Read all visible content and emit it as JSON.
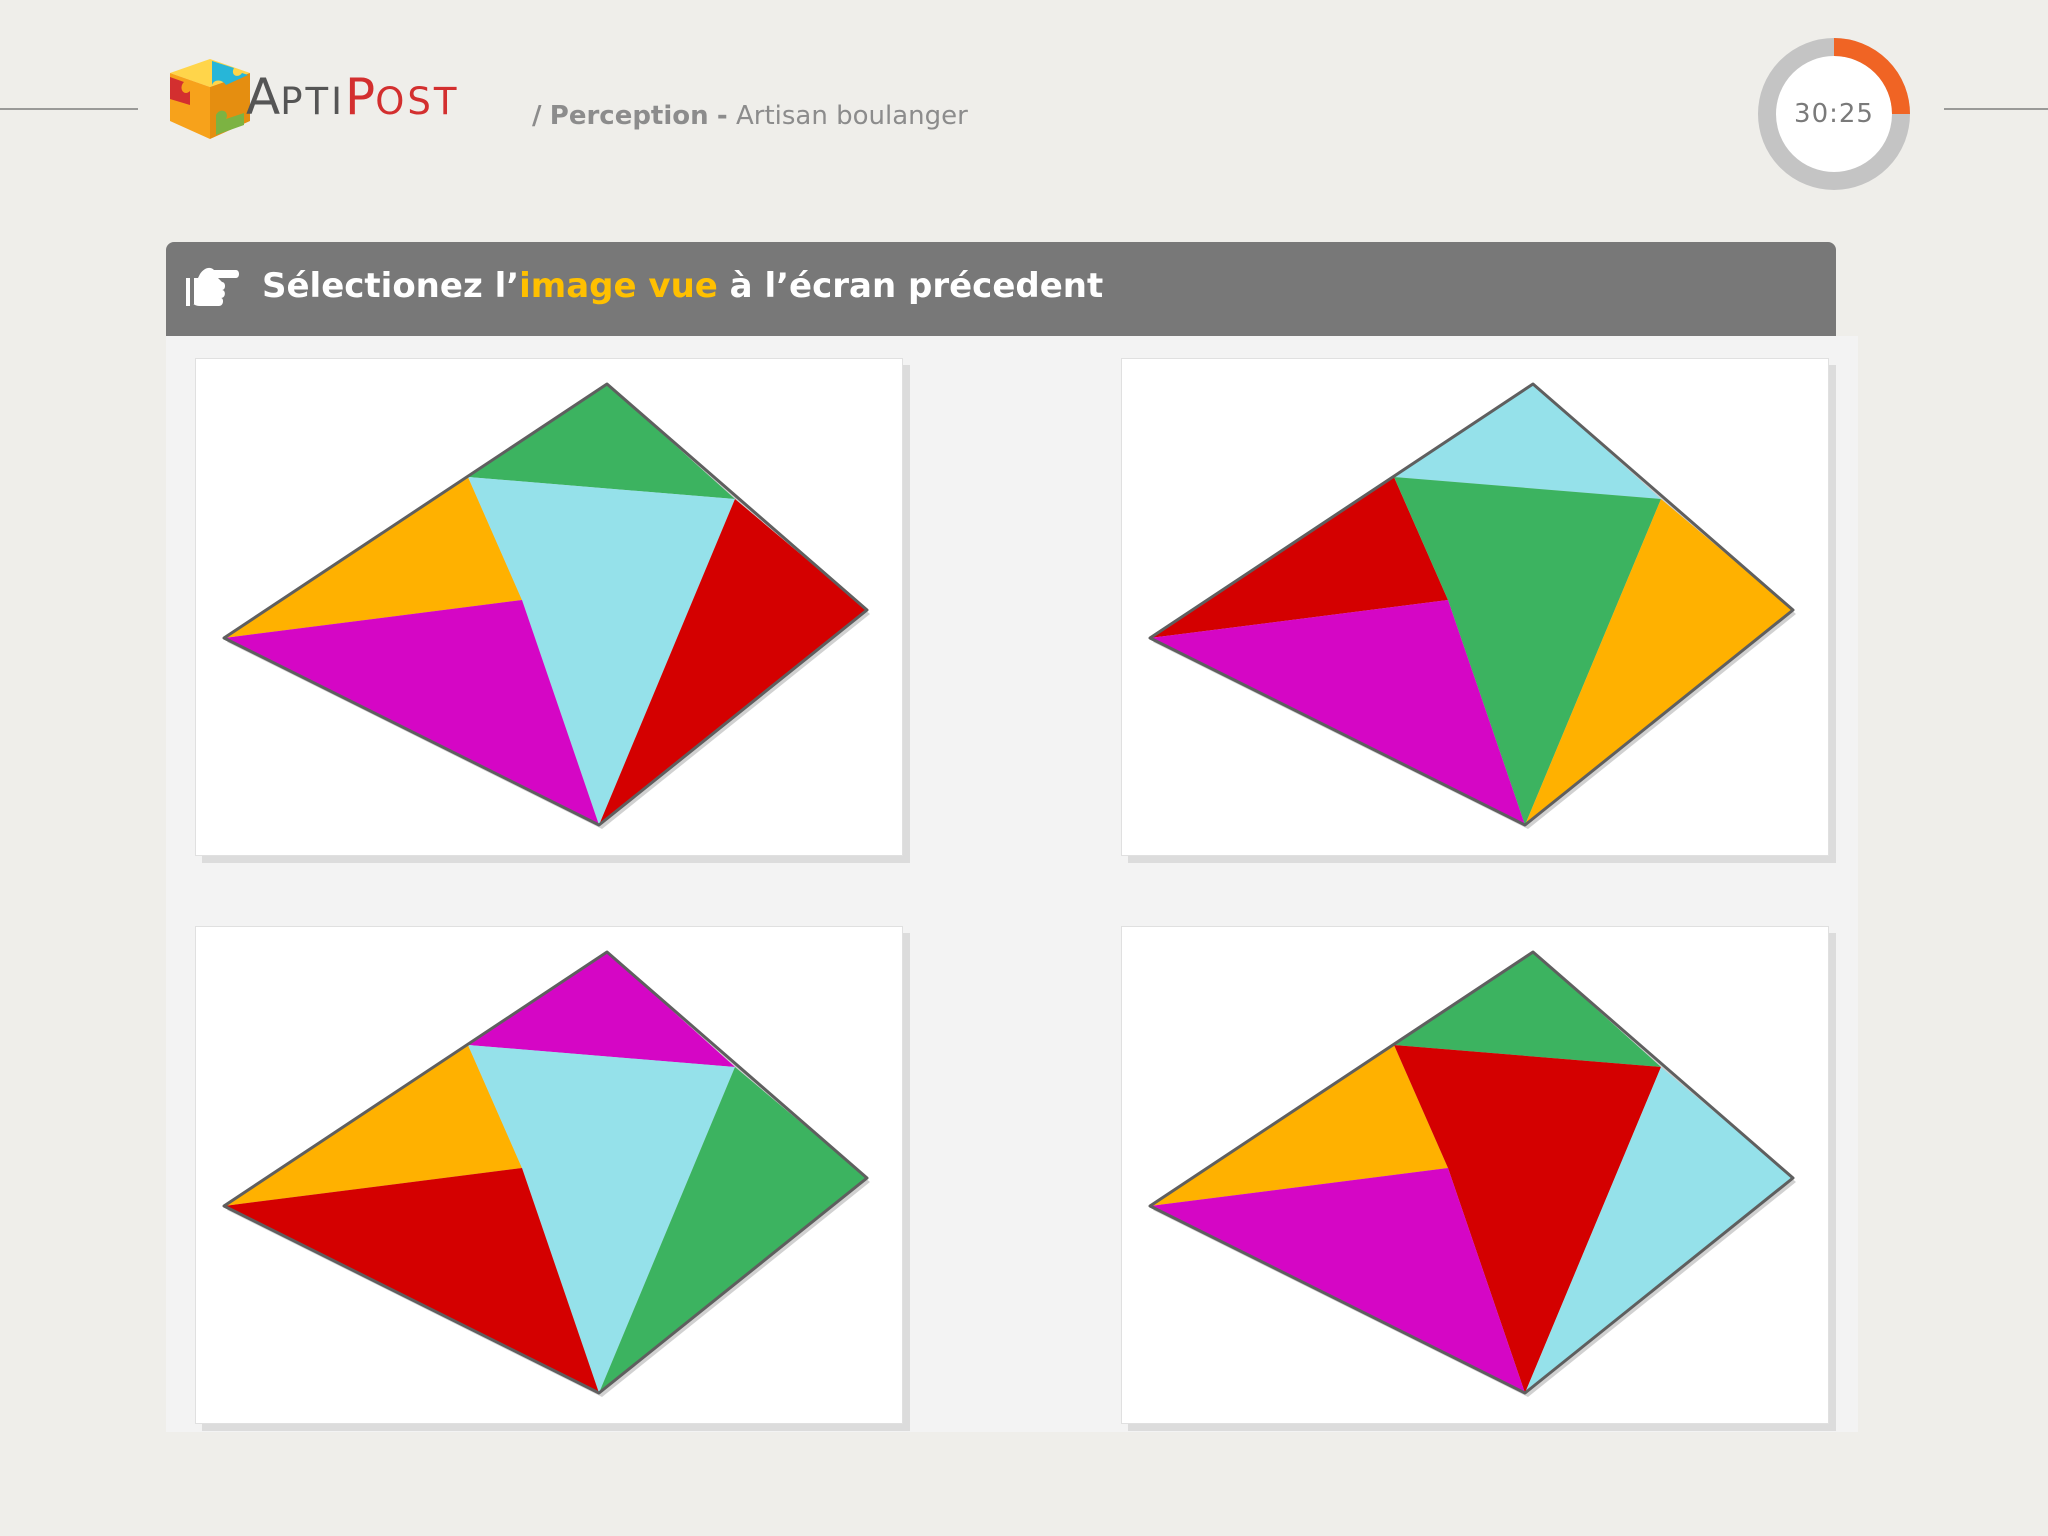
{
  "app": {
    "brand_first_cap": "A",
    "brand_first_rest": "PTI",
    "brand_second_cap": "P",
    "brand_second_rest": "OST",
    "logo_icon": "puzzle-cube-icon"
  },
  "breadcrumb": {
    "separator": "/",
    "section": "Perception",
    "dash": "-",
    "subsection": "Artisan boulanger"
  },
  "timer": {
    "display": "30:25",
    "elapsed_fraction": 0.25
  },
  "instruction": {
    "icon": "pointing-hand-icon",
    "before": "Sélectionez l’",
    "highlight": "image vue",
    "after": " à l’écran précedent"
  },
  "colors": {
    "green": "#3cb360",
    "cyan": "#95e1ea",
    "orange": "#ffb100",
    "red": "#d40000",
    "magenta": "#d506c5",
    "accent": "#f06424",
    "highlight": "#ffc000"
  },
  "choices": [
    {
      "id": "option-1",
      "top": "green",
      "left": "orange",
      "center": "cyan",
      "right": "red",
      "bottom_left": "magenta"
    },
    {
      "id": "option-2",
      "top": "cyan",
      "left": "red",
      "center": "green",
      "right": "orange",
      "bottom_left": "magenta"
    },
    {
      "id": "option-3",
      "top": "magenta",
      "left": "orange",
      "center": "cyan",
      "right": "green",
      "bottom_left": "red"
    },
    {
      "id": "option-4",
      "top": "green",
      "left": "orange",
      "center": "red",
      "right": "cyan",
      "bottom_left": "magenta"
    }
  ]
}
